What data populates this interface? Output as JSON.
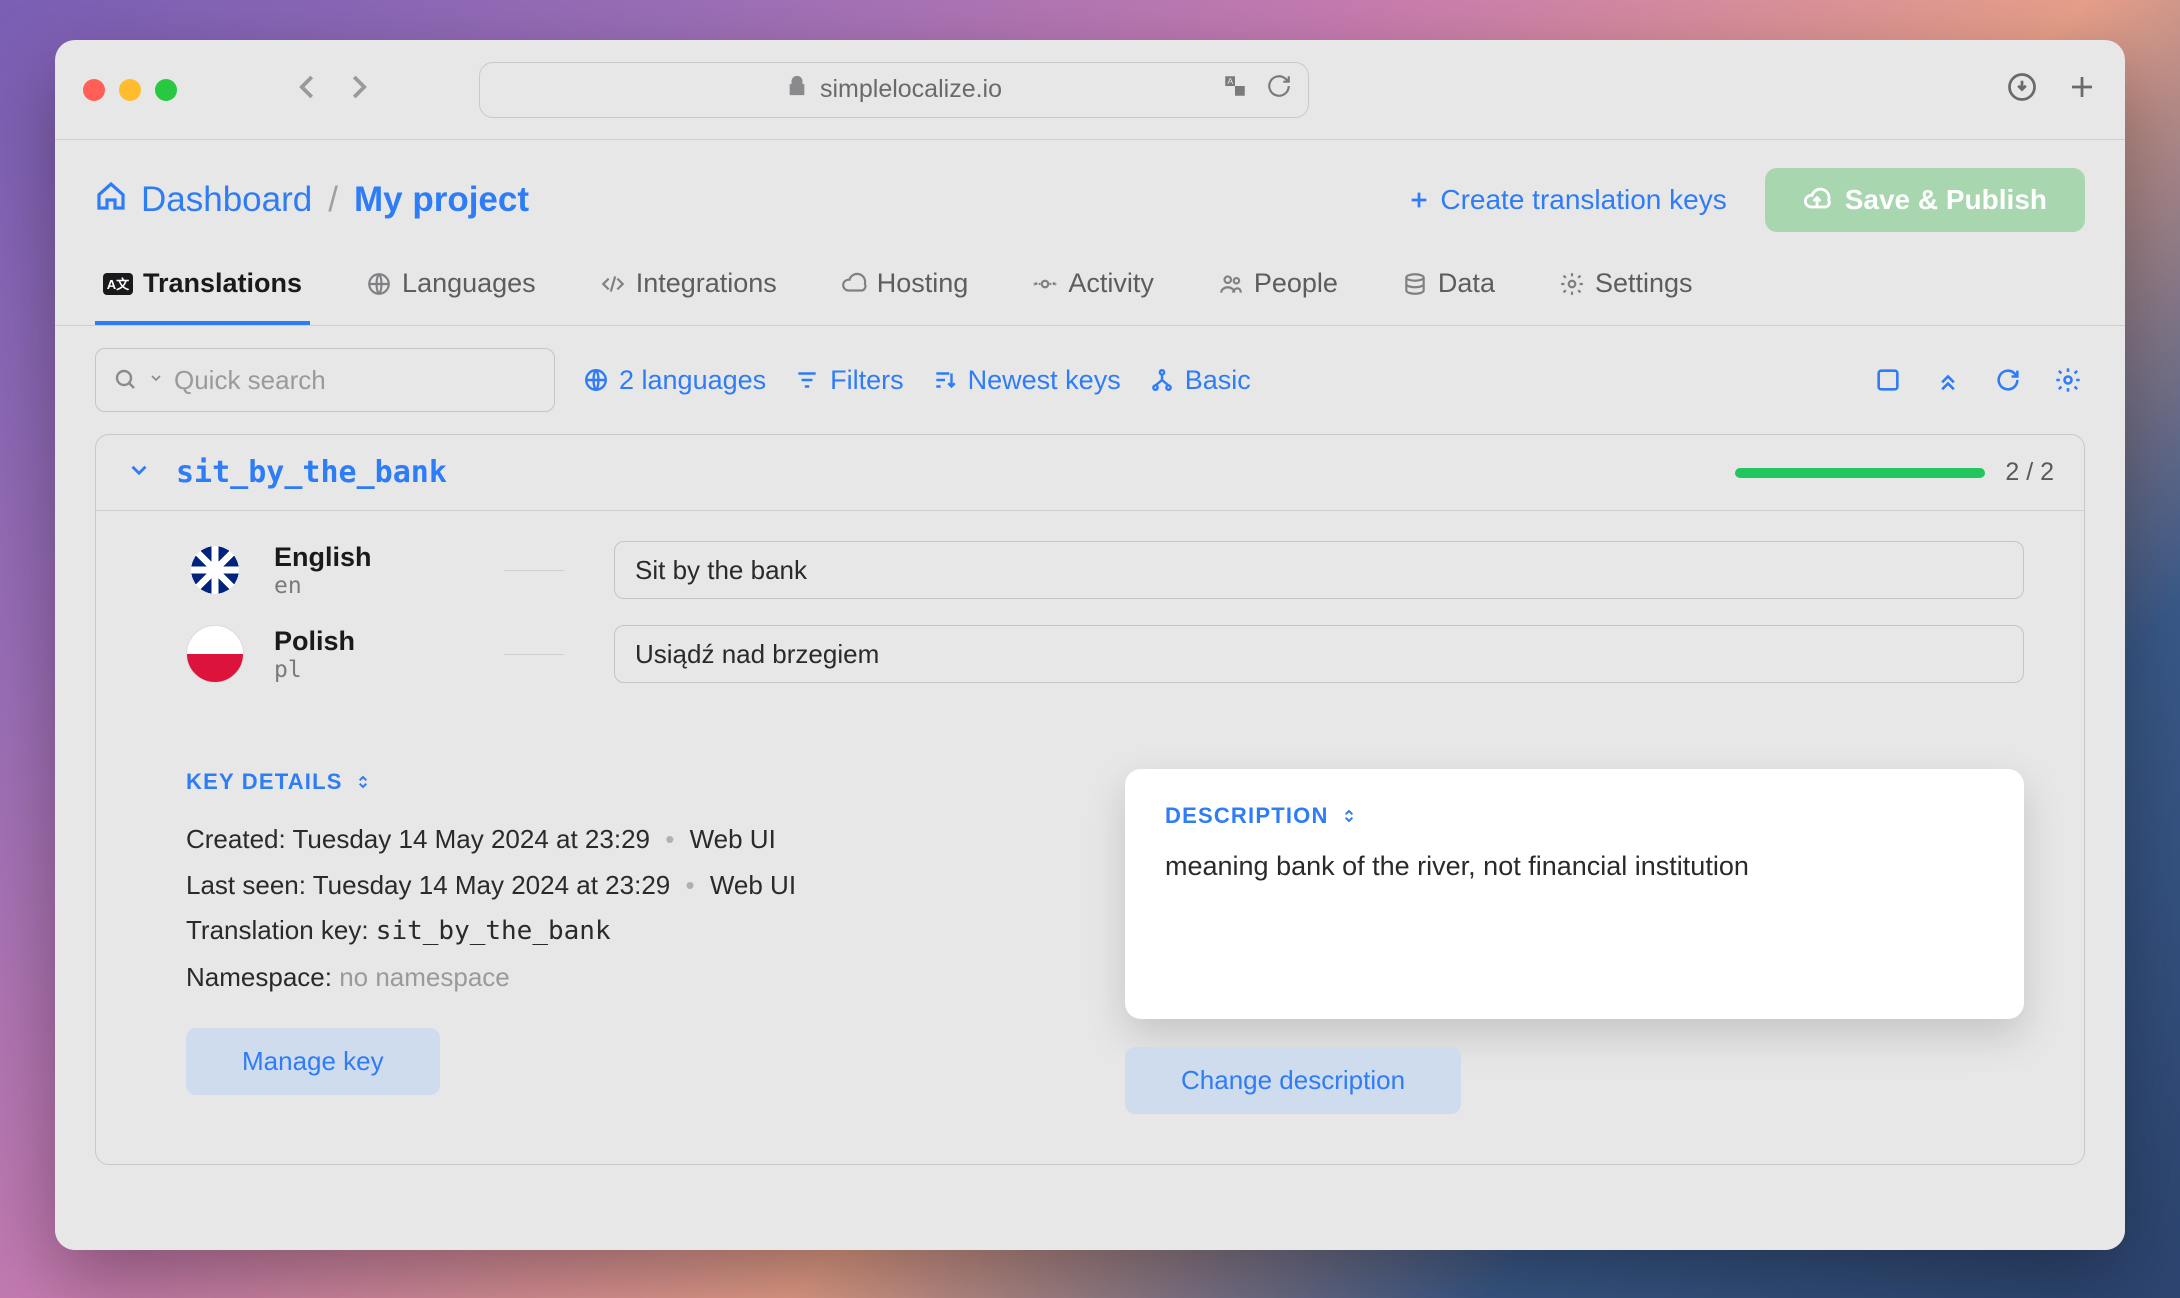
{
  "browser": {
    "url": "simplelocalize.io"
  },
  "breadcrumb": {
    "home_label": "Dashboard",
    "separator": "/",
    "current": "My project"
  },
  "header_actions": {
    "create_label": "Create translation keys",
    "save_label": "Save & Publish"
  },
  "tabs": [
    {
      "id": "translations",
      "label": "Translations"
    },
    {
      "id": "languages",
      "label": "Languages"
    },
    {
      "id": "integrations",
      "label": "Integrations"
    },
    {
      "id": "hosting",
      "label": "Hosting"
    },
    {
      "id": "activity",
      "label": "Activity"
    },
    {
      "id": "people",
      "label": "People"
    },
    {
      "id": "data",
      "label": "Data"
    },
    {
      "id": "settings",
      "label": "Settings"
    }
  ],
  "active_tab": "translations",
  "toolbar": {
    "search_placeholder": "Quick search",
    "languages_chip": "2 languages",
    "filters_chip": "Filters",
    "sort_chip": "Newest keys",
    "view_chip": "Basic"
  },
  "key": {
    "name": "sit_by_the_bank",
    "progress_done": 2,
    "progress_total": 2,
    "progress_text": "2 / 2"
  },
  "translations": [
    {
      "lang_name": "English",
      "lang_code": "en",
      "value": "Sit by the bank",
      "flag": "uk"
    },
    {
      "lang_name": "Polish",
      "lang_code": "pl",
      "value": "Usiądź nad brzegiem",
      "flag": "pl"
    }
  ],
  "key_details": {
    "section_title": "KEY DETAILS",
    "created_label": "Created:",
    "created_value": "Tuesday 14 May 2024 at 23:29",
    "created_source": "Web UI",
    "lastseen_label": "Last seen:",
    "lastseen_value": "Tuesday 14 May 2024 at 23:29",
    "lastseen_source": "Web UI",
    "translation_key_label": "Translation key:",
    "translation_key_value": "sit_by_the_bank",
    "namespace_label": "Namespace:",
    "namespace_value": "no namespace",
    "manage_button": "Manage key"
  },
  "description": {
    "section_title": "DESCRIPTION",
    "text": "meaning bank of the river, not financial institution",
    "change_button": "Change description"
  }
}
